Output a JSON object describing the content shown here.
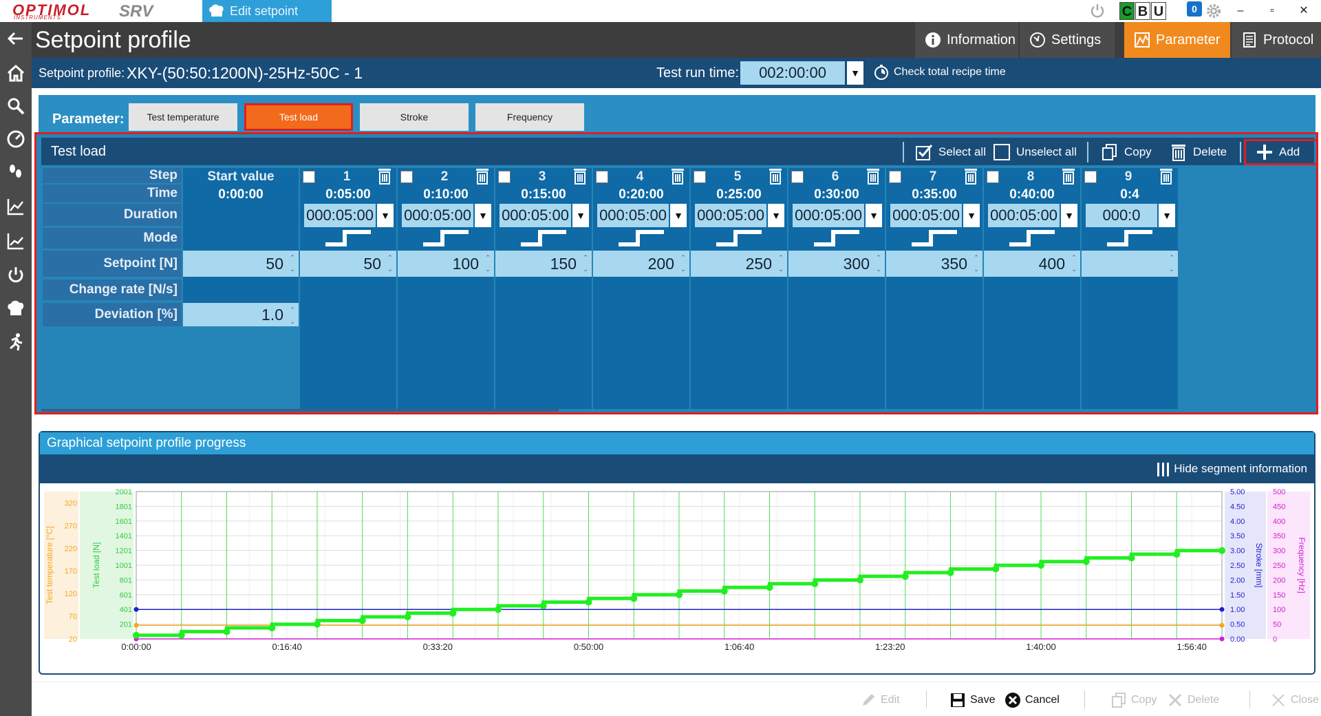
{
  "window": {
    "logo_main": "OPTIMOL",
    "logo_sub": "INSTRUMENTS",
    "logo_srv": "SRV",
    "tab_title": "Edit setpoint profile",
    "letters": [
      "C",
      "B",
      "U"
    ],
    "notification_count": "0",
    "minimize": "–",
    "restore": "▫",
    "close": "✕"
  },
  "header": {
    "title": "Setpoint profile",
    "tabs": [
      {
        "label": "Information",
        "icon": "info-icon"
      },
      {
        "label": "Settings",
        "icon": "settings-icon"
      },
      {
        "label": "Parameter",
        "icon": "parameter-icon",
        "active": true
      },
      {
        "label": "Protocol",
        "icon": "protocol-icon"
      }
    ]
  },
  "info_bar": {
    "profile_label": "Setpoint profile:",
    "profile_value": "XKY-(50:50:1200N)-25Hz-50C - 1",
    "run_time_label": "Test run time:",
    "run_time_value": "002:00:00",
    "check_total": "Check total recipe time"
  },
  "parameter": {
    "label": "Parameter:",
    "buttons": [
      "Test temperature",
      "Test load",
      "Stroke",
      "Frequency"
    ],
    "active": "Test load"
  },
  "table": {
    "title": "Test load",
    "actions": {
      "select_all": "Select all",
      "unselect_all": "Unselect all",
      "copy": "Copy",
      "delete": "Delete",
      "add": "Add"
    },
    "row_labels": {
      "step": "Step",
      "time": "Time",
      "duration": "Duration",
      "mode": "Mode",
      "setpoint": "Setpoint [N]",
      "change_rate": "Change rate [N/s]",
      "deviation": "Deviation [%]"
    },
    "start": {
      "header": "Start value",
      "time": "0:00:00",
      "setpoint": "50",
      "deviation": "1.0"
    },
    "steps": [
      {
        "step": "1",
        "time": "0:05:00",
        "duration": "000:05:00",
        "setpoint": "50"
      },
      {
        "step": "2",
        "time": "0:10:00",
        "duration": "000:05:00",
        "setpoint": "100"
      },
      {
        "step": "3",
        "time": "0:15:00",
        "duration": "000:05:00",
        "setpoint": "150"
      },
      {
        "step": "4",
        "time": "0:20:00",
        "duration": "000:05:00",
        "setpoint": "200"
      },
      {
        "step": "5",
        "time": "0:25:00",
        "duration": "000:05:00",
        "setpoint": "250"
      },
      {
        "step": "6",
        "time": "0:30:00",
        "duration": "000:05:00",
        "setpoint": "300"
      },
      {
        "step": "7",
        "time": "0:35:00",
        "duration": "000:05:00",
        "setpoint": "350"
      },
      {
        "step": "8",
        "time": "0:40:00",
        "duration": "000:05:00",
        "setpoint": "400"
      },
      {
        "step": "9",
        "time": "0:4",
        "duration": "000:0",
        "setpoint": ""
      }
    ]
  },
  "graph": {
    "title": "Graphical setpoint profile progress",
    "hide_segment": "Hide segment information"
  },
  "chart_data": {
    "type": "line",
    "xlabel": "",
    "x_tick_labels": [
      "0:00:00",
      "0:16:40",
      "0:33:20",
      "0:50:00",
      "1:06:40",
      "1:23:20",
      "1:40:00",
      "1:56:40"
    ],
    "x_tick_minutes": [
      0,
      16.667,
      33.333,
      50,
      66.667,
      83.333,
      100,
      116.667
    ],
    "xlim_minutes": [
      0,
      120
    ],
    "axes": [
      {
        "label": "Test temperature [°C]",
        "color": "#f5a623",
        "ticks": [
          "20",
          "70",
          "120",
          "170",
          "220",
          "270",
          "320"
        ],
        "lim": [
          20,
          345
        ]
      },
      {
        "label": "Test load [N]",
        "color": "#2ecc40",
        "ticks": [
          "201",
          "401",
          "601",
          "801",
          "1001",
          "1201",
          "1401",
          "1601",
          "1801",
          "2001"
        ],
        "lim": [
          1,
          2001
        ]
      },
      {
        "label": "Stroke [mm]",
        "color": "#1f1fd1",
        "ticks": [
          "0.00",
          "0.50",
          "1.00",
          "1.50",
          "2.00",
          "2.50",
          "3.00",
          "3.50",
          "4.00",
          "4.50",
          "5.00"
        ],
        "lim": [
          0,
          5
        ]
      },
      {
        "label": "Frequency [Hz]",
        "color": "#d21fd2",
        "ticks": [
          "0",
          "50",
          "100",
          "150",
          "200",
          "250",
          "300",
          "350",
          "400",
          "450",
          "500"
        ],
        "lim": [
          0,
          500
        ]
      }
    ],
    "series": [
      {
        "name": "Test load [N]",
        "axis": 1,
        "color": "#22ee22",
        "x_minutes": [
          0,
          5,
          5,
          10,
          10,
          15,
          15,
          20,
          20,
          25,
          25,
          30,
          30,
          35,
          35,
          40,
          40,
          45,
          45,
          50,
          50,
          55,
          55,
          60,
          60,
          65,
          65,
          70,
          70,
          75,
          75,
          80,
          80,
          85,
          85,
          90,
          90,
          95,
          95,
          100,
          100,
          105,
          105,
          110,
          110,
          115,
          115,
          120
        ],
        "values": [
          50,
          50,
          100,
          100,
          150,
          150,
          200,
          200,
          250,
          250,
          300,
          300,
          350,
          350,
          400,
          400,
          450,
          450,
          500,
          500,
          550,
          550,
          600,
          600,
          650,
          650,
          700,
          700,
          750,
          750,
          800,
          800,
          850,
          850,
          900,
          900,
          950,
          950,
          1000,
          1000,
          1050,
          1050,
          1100,
          1100,
          1150,
          1150,
          1200,
          1200
        ]
      },
      {
        "name": "Stroke [mm]",
        "axis": 2,
        "color": "#1f1fd1",
        "x_minutes": [
          0,
          120
        ],
        "values": [
          1.0,
          1.0
        ]
      },
      {
        "name": "Test temperature [°C]",
        "axis": 0,
        "color": "#f5a623",
        "x_minutes": [
          0,
          120
        ],
        "values": [
          50,
          50
        ]
      },
      {
        "name": "Frequency [Hz]",
        "axis": 3,
        "color": "#d21fd2",
        "x_minutes": [
          0,
          120
        ],
        "values": [
          0,
          0
        ]
      }
    ]
  },
  "footer": {
    "edit": "Edit",
    "save": "Save",
    "cancel": "Cancel",
    "copy": "Copy",
    "delete": "Delete",
    "close": "Close"
  }
}
